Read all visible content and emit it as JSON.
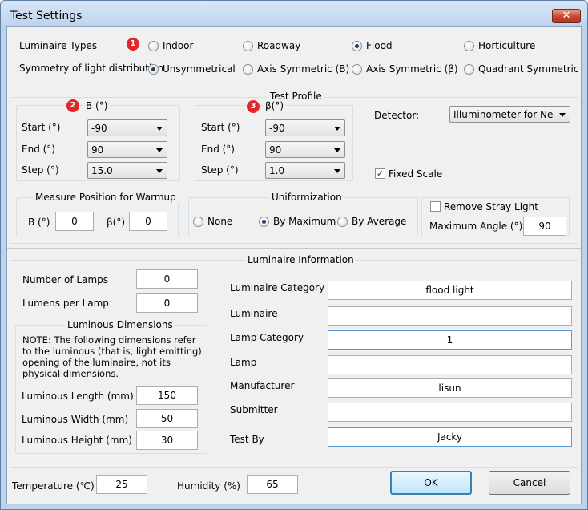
{
  "window": {
    "title": "Test Settings",
    "close_glyph": "✕"
  },
  "badges": [
    "1",
    "2",
    "3"
  ],
  "luminaire_types": {
    "label": "Luminaire Types",
    "options": [
      "Indoor",
      "Roadway",
      "Flood",
      "Horticulture"
    ],
    "selected": "Flood"
  },
  "symmetry": {
    "label": "Symmetry of light distribution",
    "options": [
      "Unsymmetrical",
      "Axis Symmetric (B)",
      "Axis Symmetric (β)",
      "Quadrant Symmetric"
    ],
    "selected": "Unsymmetrical"
  },
  "test_profile": {
    "title": "Test Profile",
    "b_group": {
      "title": "B (°)",
      "start_label": "Start (°)",
      "start": "-90",
      "end_label": "End (°)",
      "end": "90",
      "step_label": "Step (°)",
      "step": "15.0"
    },
    "beta_group": {
      "title": "β(°)",
      "start_label": "Start (°)",
      "start": "-90",
      "end_label": "End (°)",
      "end": "90",
      "step_label": "Step (°)",
      "step": "1.0"
    },
    "detector_label": "Detector:",
    "detector": "Illuminometer for Near F",
    "fixed_scale_label": "Fixed Scale",
    "fixed_scale_checked": true
  },
  "warmup": {
    "title": "Measure Position for Warmup",
    "b_label": "B (°)",
    "b_value": "0",
    "beta_label": "β(°)",
    "beta_value": "0"
  },
  "uniformization": {
    "title": "Uniformization",
    "options": [
      "None",
      "By Maximum",
      "By Average"
    ],
    "selected": "By Maximum"
  },
  "stray": {
    "remove_label": "Remove Stray Light",
    "remove_checked": false,
    "max_angle_label": "Maximum Angle (°):",
    "max_angle": "90"
  },
  "luminaire_info": {
    "title": "Luminaire Information",
    "number_of_lamps_label": "Number of Lamps",
    "number_of_lamps": "0",
    "lumens_per_lamp_label": "Lumens per Lamp",
    "lumens_per_lamp": "0",
    "dimensions": {
      "title": "Luminous Dimensions",
      "note": "NOTE: The following dimensions refer to the luminous (that is, light emitting) opening of the luminaire, not its physical dimensions.",
      "length_label": "Luminous Length (mm)",
      "length": "150",
      "width_label": "Luminous Width (mm)",
      "width": "50",
      "height_label": "Luminous Height (mm)",
      "height": "30"
    },
    "fields": [
      {
        "label": "Luminaire Category",
        "value": "flood light"
      },
      {
        "label": "Luminaire",
        "value": ""
      },
      {
        "label": "Lamp Category",
        "value": "1"
      },
      {
        "label": "Lamp",
        "value": ""
      },
      {
        "label": "Manufacturer",
        "value": "lisun"
      },
      {
        "label": "Submitter",
        "value": ""
      },
      {
        "label": "Test By",
        "value": "Jacky"
      }
    ]
  },
  "environment": {
    "temperature_label": "Temperature (℃)",
    "temperature": "25",
    "humidity_label": "Humidity (%)",
    "humidity": "65"
  },
  "buttons": {
    "ok": "OK",
    "cancel": "Cancel"
  }
}
